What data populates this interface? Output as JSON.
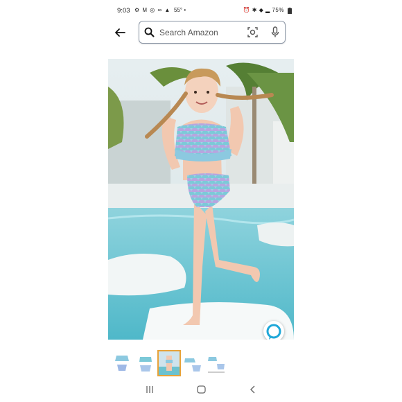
{
  "status_bar": {
    "time": "9:03",
    "notification_icons": "⚙ M ◎ ∞ ▲",
    "temperature": "55°",
    "dot": "•",
    "system_icons": "⏰ ✱ ◆ ▂",
    "battery": "75%"
  },
  "search": {
    "placeholder": "Search Amazon"
  },
  "icons": {
    "back": "arrow-left-icon",
    "search": "magnifier-icon",
    "camera": "camera-lens-icon",
    "mic": "microphone-icon",
    "alexa": "alexa-icon"
  },
  "thumbnails": {
    "count": 5,
    "selected_index": 2
  },
  "colors": {
    "search_border": "#8b96a5",
    "selected_thumb_border": "#e8a238",
    "alexa_blue": "#1ea7d8"
  }
}
